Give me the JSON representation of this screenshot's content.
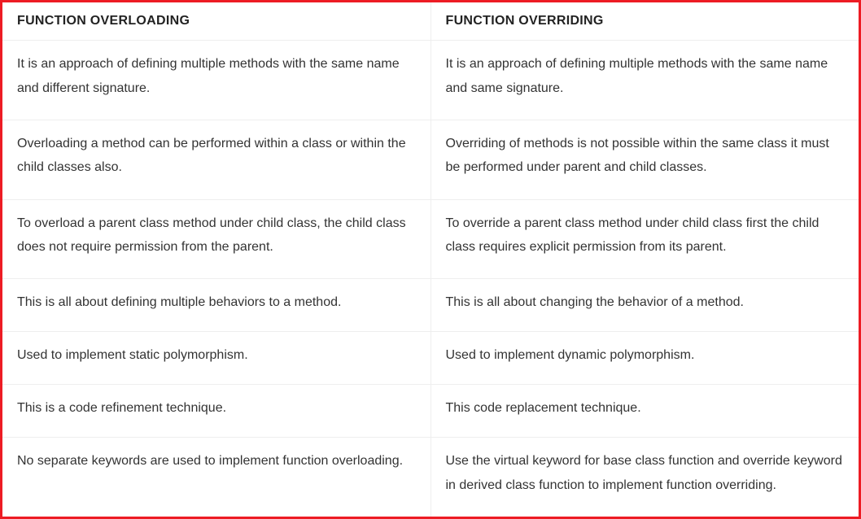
{
  "table": {
    "headers": {
      "left": "FUNCTION OVERLOADING",
      "right": "FUNCTION OVERRIDING"
    },
    "rows": [
      {
        "left": "It is an approach of defining multiple methods with the same name and different signature.",
        "right": "It is an approach of defining multiple methods with the same name and same signature."
      },
      {
        "left": "Overloading a method can be performed within a class or within the child classes also.",
        "right": "Overriding of methods is not possible within the same class it must be performed under parent and child classes."
      },
      {
        "left": "To overload a parent class method under child class, the child class does not require permission from the parent.",
        "right": "To override a parent class method under child class first the child class requires explicit permission from its parent."
      },
      {
        "left": "This is all about defining multiple behaviors to a method.",
        "right": "This is all about changing the behavior of a method."
      },
      {
        "left": "Used to implement static polymorphism.",
        "right": "Used to implement dynamic polymorphism."
      },
      {
        "left": "This is a code refinement technique.",
        "right": "This code replacement technique."
      },
      {
        "left": "No separate keywords are used to implement function overloading.",
        "right": "Use the virtual keyword for base class function and override keyword in derived class function to implement function overriding."
      }
    ]
  }
}
